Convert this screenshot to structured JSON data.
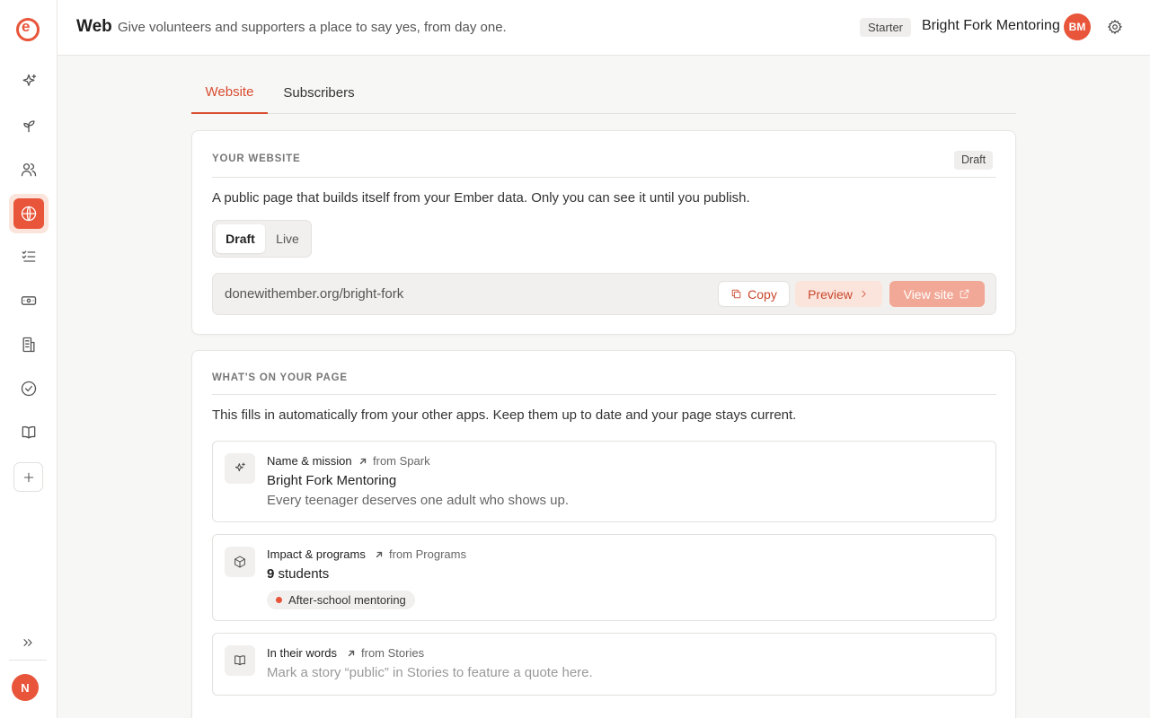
{
  "header": {
    "title": "Web",
    "subtitle": "Give volunteers and supporters a place to say yes, from day one.",
    "plan": "Starter",
    "org_name": "Bright Fork Mentoring",
    "org_initials": "BM"
  },
  "sidebar": {
    "items": [
      {
        "icon": "sparkle-icon"
      },
      {
        "icon": "sprout-icon"
      },
      {
        "icon": "people-icon"
      },
      {
        "icon": "globe-icon",
        "active": true
      },
      {
        "icon": "checklist-icon"
      },
      {
        "icon": "money-icon"
      },
      {
        "icon": "building-icon"
      },
      {
        "icon": "check-circle-icon"
      },
      {
        "icon": "book-icon"
      }
    ],
    "user_initial": "N"
  },
  "tabs": [
    {
      "label": "Website",
      "active": true
    },
    {
      "label": "Subscribers",
      "active": false
    }
  ],
  "website_card": {
    "section_label": "YOUR WEBSITE",
    "status": "Draft",
    "description": "A public page that builds itself from your Ember data. Only you can see it until you publish.",
    "toggle": {
      "options": [
        "Draft",
        "Live"
      ],
      "selected": "Draft"
    },
    "url": "donewithember.org/bright-fork",
    "copy_label": "Copy",
    "preview_label": "Preview",
    "view_site_label": "View site"
  },
  "page_card": {
    "section_label": "WHAT'S ON YOUR PAGE",
    "description": "This fills in automatically from your other apps. Keep them up to date and your page stays current.",
    "features": [
      {
        "title": "Name & mission",
        "source": "from Spark",
        "main": "Bright Fork Mentoring",
        "sub": "Every teenager deserves one adult who shows up."
      },
      {
        "title": "Impact & programs",
        "source": "from Programs",
        "main_count": "9",
        "main_unit": "students",
        "chip": "After-school mentoring"
      },
      {
        "title": "In their words",
        "source": "from Stories",
        "muted": "Mark a story “public” in Stories to feature a quote here."
      }
    ]
  },
  "colors": {
    "accent": "#e8553a",
    "accent_soft": "#fbe4dc"
  }
}
